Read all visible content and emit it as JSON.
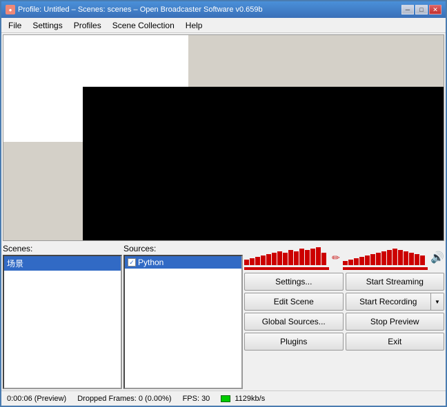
{
  "window": {
    "title": "Profile: Untitled – Scenes: scenes – Open Broadcaster Software v0.659b",
    "icon": "●"
  },
  "titlebar_controls": {
    "minimize": "─",
    "maximize": "□",
    "close": "✕"
  },
  "menu": {
    "items": [
      {
        "label": "File"
      },
      {
        "label": "Settings"
      },
      {
        "label": "Profiles"
      },
      {
        "label": "Scene Collection"
      },
      {
        "label": "Help"
      }
    ]
  },
  "scenes": {
    "label": "Scenes:",
    "items": [
      {
        "text": "场景",
        "selected": true
      }
    ]
  },
  "sources": {
    "label": "Sources:",
    "items": [
      {
        "text": "Python",
        "checked": true,
        "selected": true
      }
    ]
  },
  "meter_left": {
    "bars": [
      8,
      10,
      12,
      14,
      16,
      18,
      20,
      18,
      22,
      20,
      24,
      22,
      24,
      26,
      18,
      20
    ],
    "icon": "✏️"
  },
  "meter_right": {
    "bars": [
      6,
      8,
      10,
      12,
      14,
      16,
      18,
      20,
      22,
      24,
      22,
      20,
      18,
      16,
      14,
      12
    ],
    "volume_icon": "🔊"
  },
  "buttons": {
    "settings": "Settings...",
    "start_streaming": "Start Streaming",
    "edit_scene": "Edit Scene",
    "start_recording": "Start Recording",
    "global_sources": "Global Sources...",
    "stop_preview": "Stop Preview",
    "plugins": "Plugins",
    "exit": "Exit"
  },
  "status": {
    "time": "0:00:06 (Preview)",
    "dropped_frames": "Dropped Frames: 0 (0.00%)",
    "fps": "FPS: 30",
    "bitrate": "1129kb/s"
  }
}
